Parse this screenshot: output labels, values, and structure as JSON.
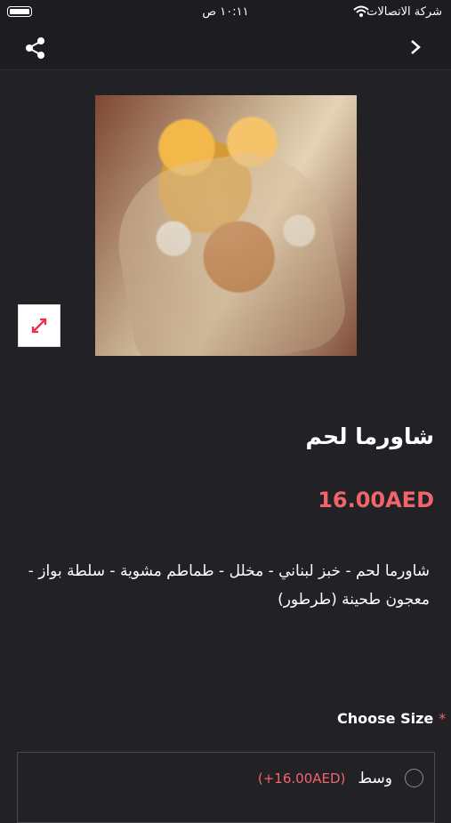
{
  "status_bar": {
    "carrier": "شركة الاتصالات",
    "time": "١٠:١١ ص"
  },
  "header": {
    "share_icon": "share-icon",
    "back_icon": "chevron-right-icon"
  },
  "product": {
    "title": "شاورما لحم",
    "price": "16.00AED",
    "description": "شاورما لحم - خبز لبناني - مخلل - طماطم مشوية - سلطة بواز - معجون طحينة (طرطور)"
  },
  "size_section": {
    "label": "Choose Size",
    "required_mark": "*",
    "options": [
      {
        "label": "وسط",
        "price": "(+16.00AED)",
        "selected": false
      }
    ]
  },
  "colors": {
    "background": "#222226",
    "accent": "#f1656a"
  }
}
